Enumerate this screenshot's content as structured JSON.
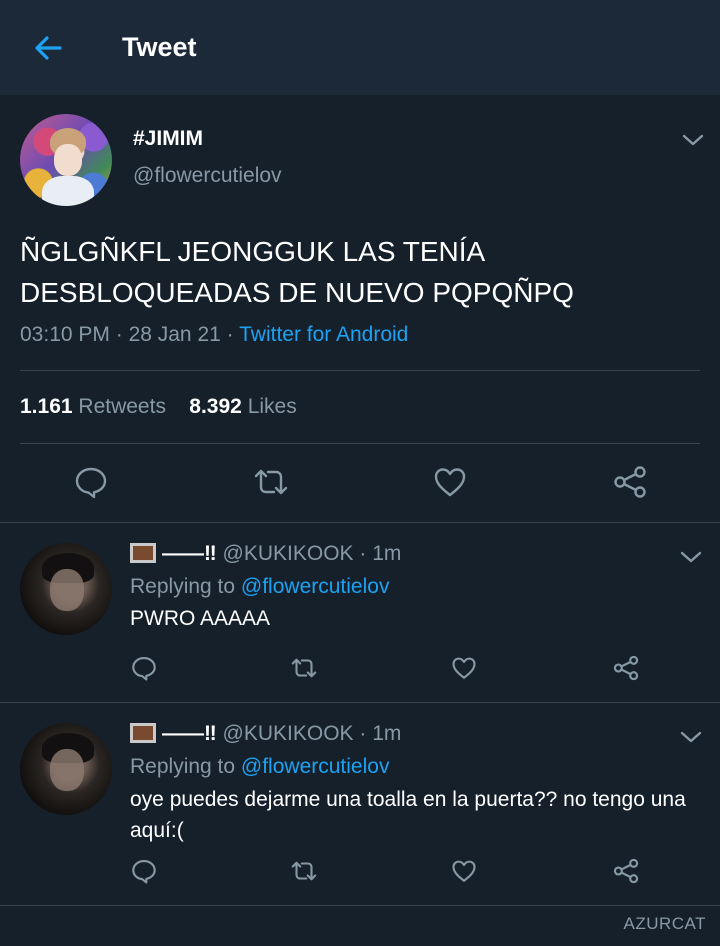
{
  "header": {
    "title": "Tweet",
    "back_icon": "arrow-left-icon"
  },
  "tweet": {
    "name": "#JIMIM",
    "handle": "@flowercutielov",
    "text": "ÑGLGÑKFL JEONGGUK LAS TENÍA DESBLOQUEADAS DE NUEVO PQPQÑPQ",
    "time": "03:10 PM",
    "date": "28 Jan 21",
    "source": "Twitter for Android",
    "sep1": " · ",
    "sep2": " · ",
    "retweets_count": "1.161",
    "retweets_label": "Retweets",
    "likes_count": "8.392",
    "likes_label": "Likes"
  },
  "replies": [
    {
      "name": "——‼",
      "handle": "@KUKIKOOK",
      "time": "· 1m",
      "replying_label": "Replying to",
      "replying_to": "@flowercutielov",
      "text": "PWRO AAAAA"
    },
    {
      "name": "——‼",
      "handle": "@KUKIKOOK",
      "time": "· 1m",
      "replying_label": "Replying to",
      "replying_to": "@flowercutielov",
      "text": "oye puedes dejarme una toalla en la puerta?? no tengo una aquí:("
    }
  ],
  "watermark": "AZURCAT",
  "colors": {
    "background": "#15202b",
    "header": "#1c2938",
    "accent": "#1da1f2",
    "muted": "#8899a6",
    "divider": "#38444d"
  }
}
